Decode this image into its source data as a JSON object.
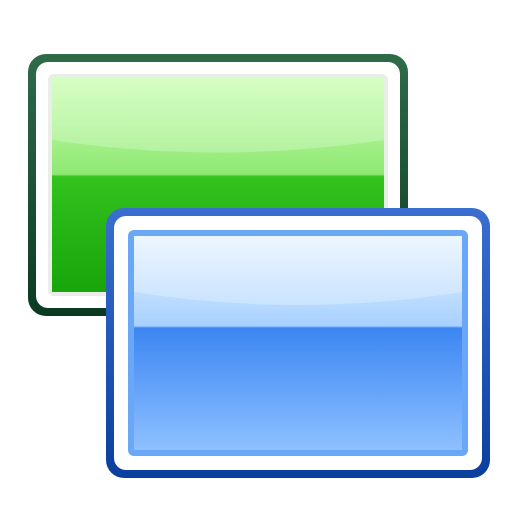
{
  "icon": {
    "name": "switch-windows-icon",
    "back_window": {
      "name": "green-window",
      "frame_color": "#0b4a2a",
      "fill_top": "#b8f5a0",
      "fill_bottom": "#1fa80f"
    },
    "front_window": {
      "name": "blue-window",
      "frame_color": "#0a3f9e",
      "fill_top": "#d7ecff",
      "fill_bottom": "#2f7ef0"
    }
  }
}
